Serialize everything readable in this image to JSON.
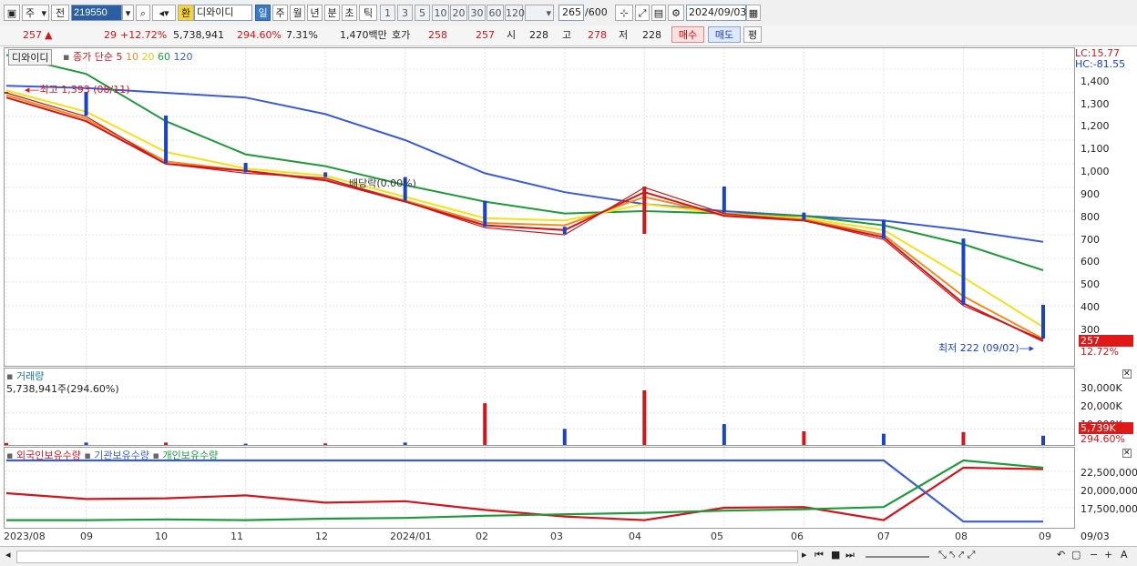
{
  "toolbar": {
    "market": "주",
    "prev_label": "전",
    "code_value": "219550",
    "ask_label": "환",
    "stock_name": "디와이디",
    "periods": [
      "일",
      "주",
      "월",
      "년",
      "분",
      "초",
      "틱"
    ],
    "active_period": "일",
    "intervals": [
      "1",
      "3",
      "5",
      "10",
      "20",
      "30",
      "60",
      "120"
    ],
    "count_value": "265",
    "count_total": "/600",
    "date_value": "2024/09/03"
  },
  "quote": {
    "price": "257",
    "change_arrow": "▲",
    "change": "29",
    "change_pct": "+12.72%",
    "volume": "5,738,941",
    "volume_ratio": "294.60%",
    "turnover": "7.31%",
    "amount": "1,470백만",
    "bid_label": "호가",
    "bid": "258",
    "ask": "257",
    "open_label": "시",
    "open": "228",
    "high_label": "고",
    "high": "278",
    "low_label": "저",
    "low": "228",
    "buy_button": "매수",
    "sell_button": "매도",
    "eval_button": "평"
  },
  "price_panel": {
    "name": "디와이디",
    "ma_label": "종가 단순",
    "ma_periods": [
      "5",
      "10",
      "20",
      "60",
      "120"
    ],
    "ma_colors": [
      "#d4141b",
      "#f08c1e",
      "#f2e21a",
      "#1f9a3a",
      "#3a5bd8"
    ],
    "lc": "LC:15.77",
    "hc": "HC:-81.55",
    "high_note": "최고 1,393 (08/11)",
    "low_note": "최저 222 (09/02)",
    "dividend_note": "배당락(0.00%)",
    "current_price_tag": "257",
    "current_pct_tag": "12.72%",
    "y_ticks": [
      "1,400",
      "1,300",
      "1,200",
      "1,100",
      "1,000",
      "900",
      "800",
      "700",
      "600",
      "500",
      "400",
      "300"
    ]
  },
  "volume_panel": {
    "title": "거래량",
    "value_text": "5,738,941주(294.60%)",
    "y_ticks": [
      "30,000K",
      "20,000K",
      "10,000K"
    ],
    "current_tag": "5,739K",
    "current_pct_tag": "294.60%"
  },
  "holdings_panel": {
    "labels": [
      "외국인보유수량",
      "기관보유수량",
      "개인보유수량"
    ],
    "colors": [
      "#d4141b",
      "#3a5bd8",
      "#1f9a3a"
    ],
    "y_ticks": [
      "22,500,000",
      "20,000,000",
      "17,500,000"
    ]
  },
  "x_axis": {
    "labels": [
      "2023/08",
      "09",
      "10",
      "11",
      "12",
      "2024/01",
      "02",
      "03",
      "04",
      "05",
      "06",
      "07",
      "08",
      "09"
    ],
    "date_tag": "09/03"
  },
  "chart_data": {
    "type": "line",
    "title": "디와이디",
    "x": [
      "2023/08",
      "09",
      "10",
      "11",
      "12",
      "2024/01",
      "02",
      "03",
      "04",
      "05",
      "06",
      "07",
      "08",
      "09"
    ],
    "series": [
      {
        "name": "종가",
        "values": [
          1300,
          1200,
          1000,
          960,
          940,
          840,
          730,
          700,
          900,
          790,
          760,
          680,
          400,
          257
        ]
      },
      {
        "name": "5",
        "values": [
          1280,
          1180,
          1000,
          970,
          930,
          840,
          740,
          720,
          880,
          780,
          760,
          690,
          410,
          250
        ]
      },
      {
        "name": "10",
        "values": [
          1290,
          1190,
          1010,
          970,
          935,
          845,
          750,
          740,
          860,
          785,
          765,
          700,
          440,
          260
        ]
      },
      {
        "name": "20",
        "values": [
          1310,
          1220,
          1050,
          980,
          950,
          860,
          770,
          760,
          830,
          790,
          770,
          720,
          520,
          310
        ]
      },
      {
        "name": "60",
        "values": [
          1460,
          1380,
          1180,
          1040,
          990,
          910,
          840,
          790,
          800,
          790,
          780,
          740,
          660,
          550
        ]
      },
      {
        "name": "120",
        "values": [
          1330,
          1320,
          1300,
          1280,
          1210,
          1100,
          960,
          880,
          830,
          800,
          780,
          760,
          720,
          670
        ]
      }
    ],
    "volume_series": {
      "name": "거래량",
      "peaks_k": [
        1200,
        1500,
        1500,
        800,
        1000,
        1500,
        26000,
        10000,
        34000,
        13000,
        8500,
        7000,
        8000,
        5739
      ]
    },
    "holdings_series": [
      {
        "name": "외국인보유수량",
        "values": [
          19500000,
          18700000,
          18800000,
          19200000,
          18200000,
          18400000,
          17200000,
          16300000,
          15800000,
          17500000,
          17600000,
          15800000,
          23000000,
          22800000
        ]
      },
      {
        "name": "기관보유수량",
        "values": [
          24000000,
          24000000,
          24000000,
          24000000,
          24000000,
          24000000,
          24000000,
          24000000,
          24000000,
          24000000,
          24000000,
          24000000,
          15600000,
          15600000
        ]
      },
      {
        "name": "개인보유수량",
        "values": [
          15800000,
          15800000,
          15900000,
          15800000,
          16000000,
          16100000,
          16400000,
          16600000,
          16800000,
          17100000,
          17300000,
          17600000,
          24000000,
          23000000
        ]
      }
    ],
    "ylim": [
      200,
      1450
    ]
  }
}
